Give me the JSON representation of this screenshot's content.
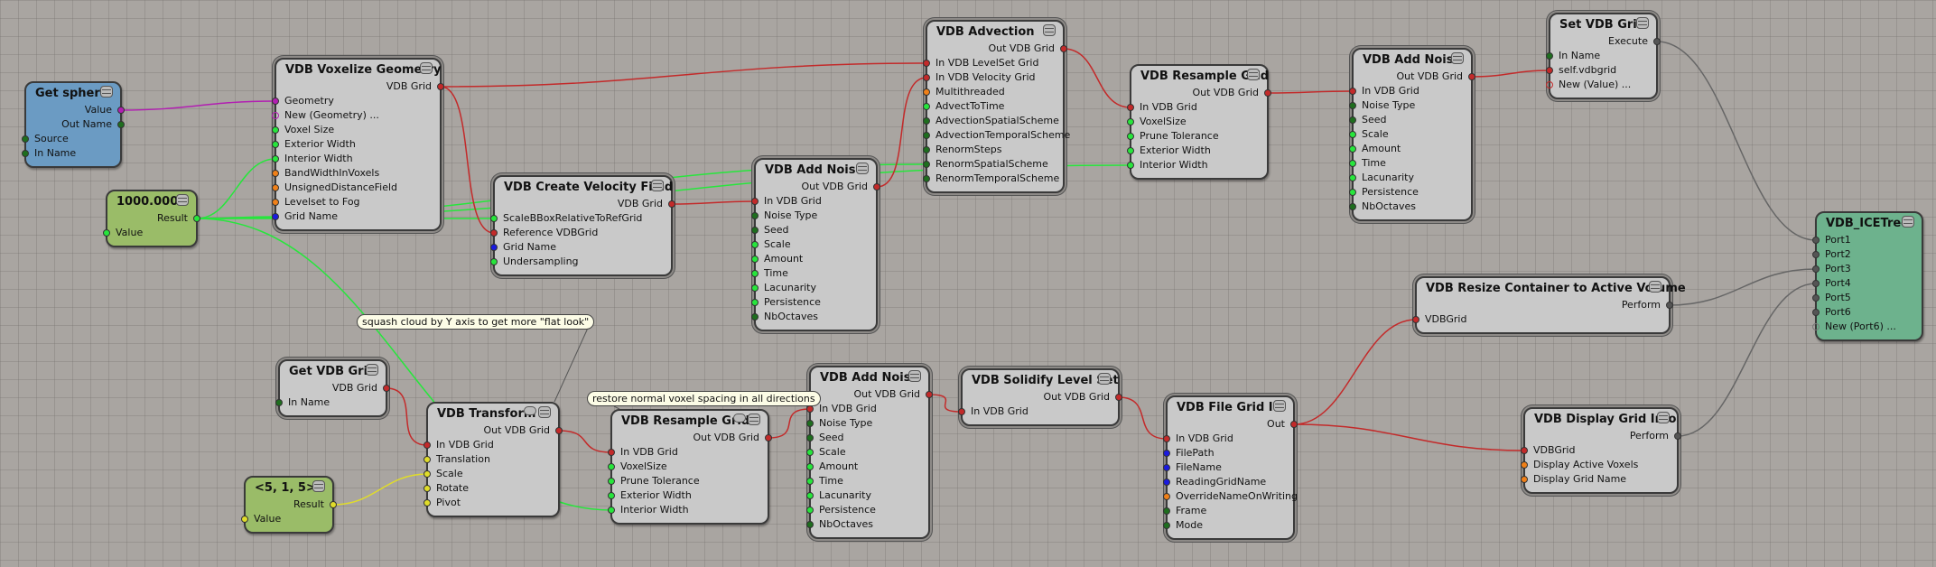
{
  "colors": {
    "geometry": "#b21fb2",
    "vdb": "#c32a2a",
    "scalar_light": "#27e63c",
    "scalar_dark": "#1e6e1e",
    "bool": "#f08018",
    "string": "#1a1ae0",
    "vector": "#e0dc2a",
    "execute": "#555555",
    "new_port": "#b21fb2"
  },
  "comments": [
    {
      "id": "c1",
      "text": "squash cloud by Y axis to get more \"flat look\""
    },
    {
      "id": "c2",
      "text": "restore normal voxel spacing in all directions"
    }
  ],
  "nodes": [
    {
      "id": "get_sphere",
      "title": "Get sphere",
      "style": "blue",
      "outputs": [
        {
          "label": "Value",
          "type": "geometry"
        },
        {
          "label": "Out Name",
          "type": "scalar_dark"
        }
      ],
      "inputs": [
        {
          "label": "Source",
          "type": "scalar_dark"
        },
        {
          "label": "In Name",
          "type": "scalar_dark"
        }
      ]
    },
    {
      "id": "const_1000",
      "title": "1000.000",
      "style": "green",
      "outputs": [
        {
          "label": "Result",
          "type": "scalar_light"
        }
      ],
      "inputs": [
        {
          "label": "Value",
          "type": "scalar_light"
        }
      ]
    },
    {
      "id": "voxelize",
      "title": "VDB Voxelize Geometry",
      "style": "grey",
      "outputs": [
        {
          "label": "VDB Grid",
          "type": "vdb"
        }
      ],
      "inputs": [
        {
          "label": "Geometry",
          "type": "geometry"
        },
        {
          "label": "New (Geometry) ...",
          "type": "new_geometry"
        },
        {
          "label": "Voxel Size",
          "type": "scalar_light"
        },
        {
          "label": "Exterior Width",
          "type": "scalar_light"
        },
        {
          "label": "Interior Width",
          "type": "scalar_light"
        },
        {
          "label": "BandWidthInVoxels",
          "type": "bool"
        },
        {
          "label": "UnsignedDistanceField",
          "type": "bool"
        },
        {
          "label": "Levelset to Fog",
          "type": "bool"
        },
        {
          "label": "Grid Name",
          "type": "string"
        }
      ]
    },
    {
      "id": "velocity",
      "title": "VDB Create Velocity Field",
      "style": "grey",
      "outputs": [
        {
          "label": "VDB Grid",
          "type": "vdb"
        }
      ],
      "inputs": [
        {
          "label": "ScaleBBoxRelativeToRefGrid",
          "type": "scalar_light"
        },
        {
          "label": "Reference VDBGrid",
          "type": "vdb"
        },
        {
          "label": "Grid Name",
          "type": "string"
        },
        {
          "label": "Undersampling",
          "type": "scalar_light"
        }
      ]
    },
    {
      "id": "noise1",
      "title": "VDB Add Noise",
      "style": "grey",
      "outputs": [
        {
          "label": "Out VDB Grid",
          "type": "vdb"
        }
      ],
      "inputs": [
        {
          "label": "In VDB Grid",
          "type": "vdb"
        },
        {
          "label": "Noise Type",
          "type": "scalar_dark"
        },
        {
          "label": "Seed",
          "type": "scalar_dark"
        },
        {
          "label": "Scale",
          "type": "scalar_light"
        },
        {
          "label": "Amount",
          "type": "scalar_light"
        },
        {
          "label": "Time",
          "type": "scalar_light"
        },
        {
          "label": "Lacunarity",
          "type": "scalar_light"
        },
        {
          "label": "Persistence",
          "type": "scalar_light"
        },
        {
          "label": "NbOctaves",
          "type": "scalar_dark"
        }
      ]
    },
    {
      "id": "advection",
      "title": "VDB Advection",
      "style": "grey",
      "outputs": [
        {
          "label": "Out VDB Grid",
          "type": "vdb"
        }
      ],
      "inputs": [
        {
          "label": "In VDB LevelSet Grid",
          "type": "vdb"
        },
        {
          "label": "In VDB Velocity Grid",
          "type": "vdb"
        },
        {
          "label": "Multithreaded",
          "type": "bool"
        },
        {
          "label": "AdvectToTime",
          "type": "scalar_light"
        },
        {
          "label": "AdvectionSpatialScheme",
          "type": "scalar_dark"
        },
        {
          "label": "AdvectionTemporalScheme",
          "type": "scalar_dark"
        },
        {
          "label": "RenormSteps",
          "type": "scalar_dark"
        },
        {
          "label": "RenormSpatialScheme",
          "type": "scalar_dark"
        },
        {
          "label": "RenormTemporalScheme",
          "type": "scalar_dark"
        }
      ]
    },
    {
      "id": "resample1",
      "title": "VDB Resample Grid",
      "style": "grey",
      "outputs": [
        {
          "label": "Out VDB Grid",
          "type": "vdb"
        }
      ],
      "inputs": [
        {
          "label": "In VDB Grid",
          "type": "vdb"
        },
        {
          "label": "VoxelSize",
          "type": "scalar_light"
        },
        {
          "label": "Prune Tolerance",
          "type": "scalar_light"
        },
        {
          "label": "Exterior Width",
          "type": "scalar_light"
        },
        {
          "label": "Interior Width",
          "type": "scalar_light"
        }
      ]
    },
    {
      "id": "noise2",
      "title": "VDB Add Noise",
      "style": "grey",
      "outputs": [
        {
          "label": "Out VDB Grid",
          "type": "vdb"
        }
      ],
      "inputs": [
        {
          "label": "In VDB Grid",
          "type": "vdb"
        },
        {
          "label": "Noise Type",
          "type": "scalar_dark"
        },
        {
          "label": "Seed",
          "type": "scalar_dark"
        },
        {
          "label": "Scale",
          "type": "scalar_light"
        },
        {
          "label": "Amount",
          "type": "scalar_light"
        },
        {
          "label": "Time",
          "type": "scalar_light"
        },
        {
          "label": "Lacunarity",
          "type": "scalar_light"
        },
        {
          "label": "Persistence",
          "type": "scalar_light"
        },
        {
          "label": "NbOctaves",
          "type": "scalar_dark"
        }
      ]
    },
    {
      "id": "set_grid",
      "title": "Set VDB Grid",
      "style": "grey",
      "outputs": [
        {
          "label": "Execute",
          "type": "execute"
        }
      ],
      "inputs": [
        {
          "label": "In Name",
          "type": "scalar_dark"
        },
        {
          "label": "self.vdbgrid",
          "type": "vdb"
        },
        {
          "label": "New (Value) ...",
          "type": "new_value"
        }
      ]
    },
    {
      "id": "icetree",
      "title": "VDB_ICETree",
      "style": "teal",
      "outputs": [],
      "inputs": [
        {
          "label": "Port1",
          "type": "execute"
        },
        {
          "label": "Port2",
          "type": "execute"
        },
        {
          "label": "Port3",
          "type": "execute"
        },
        {
          "label": "Port4",
          "type": "execute"
        },
        {
          "label": "Port5",
          "type": "execute"
        },
        {
          "label": "Port6",
          "type": "execute"
        },
        {
          "label": "New (Port6) ...",
          "type": "new_exec"
        }
      ]
    },
    {
      "id": "resize",
      "title": "VDB Resize Container to Active Volume",
      "style": "grey",
      "outputs": [
        {
          "label": "Perform",
          "type": "execute"
        }
      ],
      "inputs": [
        {
          "label": "VDBGrid",
          "type": "vdb"
        }
      ]
    },
    {
      "id": "display",
      "title": "VDB Display Grid Info",
      "style": "grey",
      "outputs": [
        {
          "label": "Perform",
          "type": "execute"
        }
      ],
      "inputs": [
        {
          "label": "VDBGrid",
          "type": "vdb"
        },
        {
          "label": "Display Active Voxels",
          "type": "bool"
        },
        {
          "label": "Display Grid Name",
          "type": "bool"
        }
      ]
    },
    {
      "id": "get_grid",
      "title": "Get VDB Grid",
      "style": "grey",
      "outputs": [
        {
          "label": "VDB Grid",
          "type": "vdb"
        }
      ],
      "inputs": [
        {
          "label": "In Name",
          "type": "scalar_dark"
        }
      ]
    },
    {
      "id": "vec_515",
      "title": "<5, 1, 5>",
      "style": "green",
      "outputs": [
        {
          "label": "Result",
          "type": "vector"
        }
      ],
      "inputs": [
        {
          "label": "Value",
          "type": "vector"
        }
      ]
    },
    {
      "id": "transform",
      "title": "VDB Transform",
      "style": "grey",
      "comment_icon": true,
      "outputs": [
        {
          "label": "Out VDB Grid",
          "type": "vdb"
        }
      ],
      "inputs": [
        {
          "label": "In VDB Grid",
          "type": "vdb"
        },
        {
          "label": "Translation",
          "type": "vector"
        },
        {
          "label": "Scale",
          "type": "vector"
        },
        {
          "label": "Rotate",
          "type": "vector"
        },
        {
          "label": "Pivot",
          "type": "vector"
        }
      ]
    },
    {
      "id": "resample2",
      "title": "VDB Resample Grid",
      "style": "grey",
      "comment_icon": true,
      "outputs": [
        {
          "label": "Out VDB Grid",
          "type": "vdb"
        }
      ],
      "inputs": [
        {
          "label": "In VDB Grid",
          "type": "vdb"
        },
        {
          "label": "VoxelSize",
          "type": "scalar_light"
        },
        {
          "label": "Prune Tolerance",
          "type": "scalar_light"
        },
        {
          "label": "Exterior Width",
          "type": "scalar_light"
        },
        {
          "label": "Interior Width",
          "type": "scalar_light"
        }
      ]
    },
    {
      "id": "noise3",
      "title": "VDB Add Noise",
      "style": "grey",
      "outputs": [
        {
          "label": "Out VDB Grid",
          "type": "vdb"
        }
      ],
      "inputs": [
        {
          "label": "In VDB Grid",
          "type": "vdb"
        },
        {
          "label": "Noise Type",
          "type": "scalar_dark"
        },
        {
          "label": "Seed",
          "type": "scalar_dark"
        },
        {
          "label": "Scale",
          "type": "scalar_light"
        },
        {
          "label": "Amount",
          "type": "scalar_light"
        },
        {
          "label": "Time",
          "type": "scalar_light"
        },
        {
          "label": "Lacunarity",
          "type": "scalar_light"
        },
        {
          "label": "Persistence",
          "type": "scalar_light"
        },
        {
          "label": "NbOctaves",
          "type": "scalar_dark"
        }
      ]
    },
    {
      "id": "solidify",
      "title": "VDB Solidify Level Set",
      "style": "grey",
      "outputs": [
        {
          "label": "Out VDB Grid",
          "type": "vdb"
        }
      ],
      "inputs": [
        {
          "label": "In VDB Grid",
          "type": "vdb"
        }
      ]
    },
    {
      "id": "fileio",
      "title": "VDB File Grid IO",
      "style": "grey",
      "outputs": [
        {
          "label": "Out",
          "type": "vdb"
        }
      ],
      "inputs": [
        {
          "label": "In VDB Grid",
          "type": "vdb"
        },
        {
          "label": "FilePath",
          "type": "string"
        },
        {
          "label": "FileName",
          "type": "string"
        },
        {
          "label": "ReadingGridName",
          "type": "string"
        },
        {
          "label": "OverrideNameOnWriting",
          "type": "bool"
        },
        {
          "label": "Frame",
          "type": "scalar_dark"
        },
        {
          "label": "Mode",
          "type": "scalar_dark"
        }
      ]
    }
  ],
  "connections": [
    {
      "from": "get_sphere.out.0",
      "to": "voxelize.in.0",
      "type": "geometry"
    },
    {
      "from": "const_1000.out.0",
      "to": "voxelize.in.4",
      "type": "scalar_light"
    },
    {
      "from": "const_1000.out.0",
      "to": "voxelize.in.8",
      "type": "scalar_light"
    },
    {
      "from": "const_1000.out.0",
      "to": "velocity.in.0",
      "type": "scalar_light"
    },
    {
      "from": "const_1000.out.0",
      "to": "advection.in.7",
      "type": "scalar_light"
    },
    {
      "from": "const_1000.out.0",
      "to": "resample1.in.4",
      "type": "scalar_light"
    },
    {
      "from": "const_1000.out.0",
      "to": "resample2.in.4",
      "type": "scalar_light"
    },
    {
      "from": "voxelize.out.0",
      "to": "advection.in.0",
      "type": "vdb"
    },
    {
      "from": "voxelize.out.0",
      "to": "velocity.in.1",
      "type": "vdb"
    },
    {
      "from": "velocity.out.0",
      "to": "noise1.in.0",
      "type": "vdb"
    },
    {
      "from": "noise1.out.0",
      "to": "advection.in.1",
      "type": "vdb"
    },
    {
      "from": "advection.out.0",
      "to": "resample1.in.0",
      "type": "vdb"
    },
    {
      "from": "resample1.out.0",
      "to": "noise2.in.0",
      "type": "vdb"
    },
    {
      "from": "noise2.out.0",
      "to": "set_grid.in.1",
      "type": "vdb"
    },
    {
      "from": "set_grid.out.0",
      "to": "icetree.in.0",
      "type": "execute"
    },
    {
      "from": "resize.out.0",
      "to": "icetree.in.2",
      "type": "execute"
    },
    {
      "from": "display.out.0",
      "to": "icetree.in.3",
      "type": "execute"
    },
    {
      "from": "get_grid.out.0",
      "to": "transform.in.0",
      "type": "vdb"
    },
    {
      "from": "vec_515.out.0",
      "to": "transform.in.2",
      "type": "vector"
    },
    {
      "from": "transform.out.0",
      "to": "resample2.in.0",
      "type": "vdb"
    },
    {
      "from": "resample2.out.0",
      "to": "noise3.in.0",
      "type": "vdb"
    },
    {
      "from": "noise3.out.0",
      "to": "solidify.in.0",
      "type": "vdb"
    },
    {
      "from": "solidify.out.0",
      "to": "fileio.in.0",
      "type": "vdb"
    },
    {
      "from": "fileio.out.0",
      "to": "resize.in.0",
      "type": "vdb"
    },
    {
      "from": "fileio.out.0",
      "to": "display.in.0",
      "type": "vdb"
    }
  ]
}
